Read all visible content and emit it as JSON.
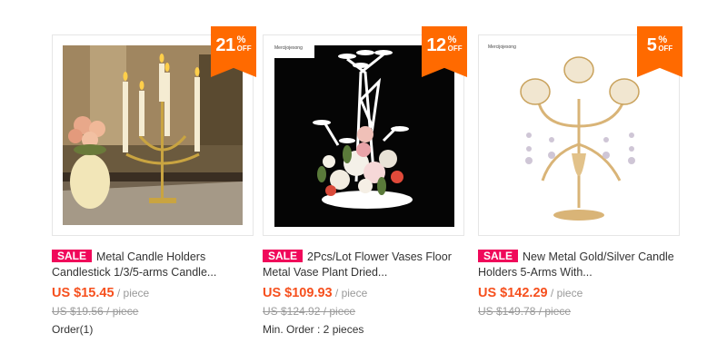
{
  "products": [
    {
      "discount_num": "21",
      "discount_pct": "%",
      "discount_off": "OFF",
      "sale_label": "SALE",
      "title": "Metal Candle Holders Candlestick 1/3/5-arms Candle...",
      "price": "US $15.45",
      "unit": " / piece",
      "old_price": "US $19.56 / piece",
      "extra": "Order(1)",
      "image_icon": "candle-holder-photo"
    },
    {
      "discount_num": "12",
      "discount_pct": "%",
      "discount_off": "OFF",
      "sale_label": "SALE",
      "title": "2Pcs/Lot Flower Vases Floor Metal Vase Plant Dried...",
      "price": "US $109.93",
      "unit": " / piece",
      "old_price": "US $124.92 / piece",
      "extra": "Min. Order : 2 pieces",
      "logo_text": "Mercijojesong",
      "image_icon": "flower-vase-photo"
    },
    {
      "discount_num": "5",
      "discount_pct": "%",
      "discount_off": "OFF",
      "sale_label": "SALE",
      "title": "New Metal Gold/Silver Candle Holders 5-Arms With...",
      "price": "US $142.29",
      "unit": " / piece",
      "old_price": "US $149.78 / piece",
      "logo_text": "Mercijojesong",
      "image_icon": "gold-candelabra-photo"
    }
  ],
  "colors": {
    "accent": "#ff6a00",
    "sale": "#f0085a",
    "price": "#f6501e"
  }
}
